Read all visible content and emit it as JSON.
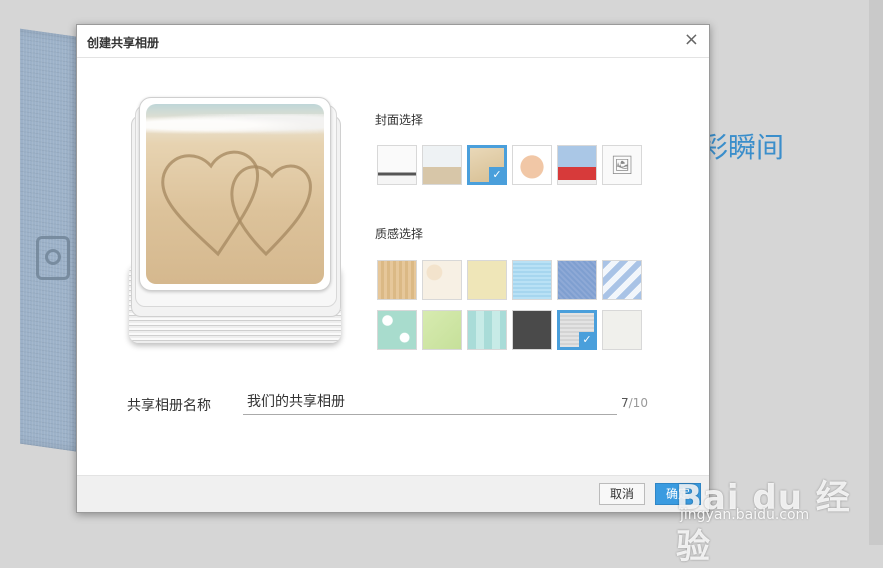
{
  "background": {
    "slogan": "彩瞬间"
  },
  "dialog": {
    "title": "创建共享相册",
    "close": "×"
  },
  "cover": {
    "label": "封面选择",
    "selected_index": 2,
    "items": [
      {
        "name": "cover-cyclist"
      },
      {
        "name": "cover-beach-people"
      },
      {
        "name": "cover-sand-hearts"
      },
      {
        "name": "cover-hands"
      },
      {
        "name": "cover-camera-girl"
      },
      {
        "name": "cover-upload",
        "icon": "image-upload-icon"
      }
    ]
  },
  "texture": {
    "label": "质感选择",
    "selected_index": 10,
    "items": [
      {
        "name": "wood"
      },
      {
        "name": "beige-floral"
      },
      {
        "name": "light-yellow"
      },
      {
        "name": "light-blue"
      },
      {
        "name": "blue-fabric"
      },
      {
        "name": "blue-stripes"
      },
      {
        "name": "teal-flowers"
      },
      {
        "name": "green-leaf"
      },
      {
        "name": "teal-plaid"
      },
      {
        "name": "dark-gray"
      },
      {
        "name": "gray-lines"
      },
      {
        "name": "off-white"
      }
    ]
  },
  "album_name": {
    "label": "共享相册名称",
    "value": "我们的共享相册",
    "count": "7",
    "max": "/10"
  },
  "footer": {
    "cancel": "取消",
    "confirm": "确定"
  },
  "watermark": {
    "logo": "Bai du 经验",
    "url": "jingyan.baidu.com"
  }
}
